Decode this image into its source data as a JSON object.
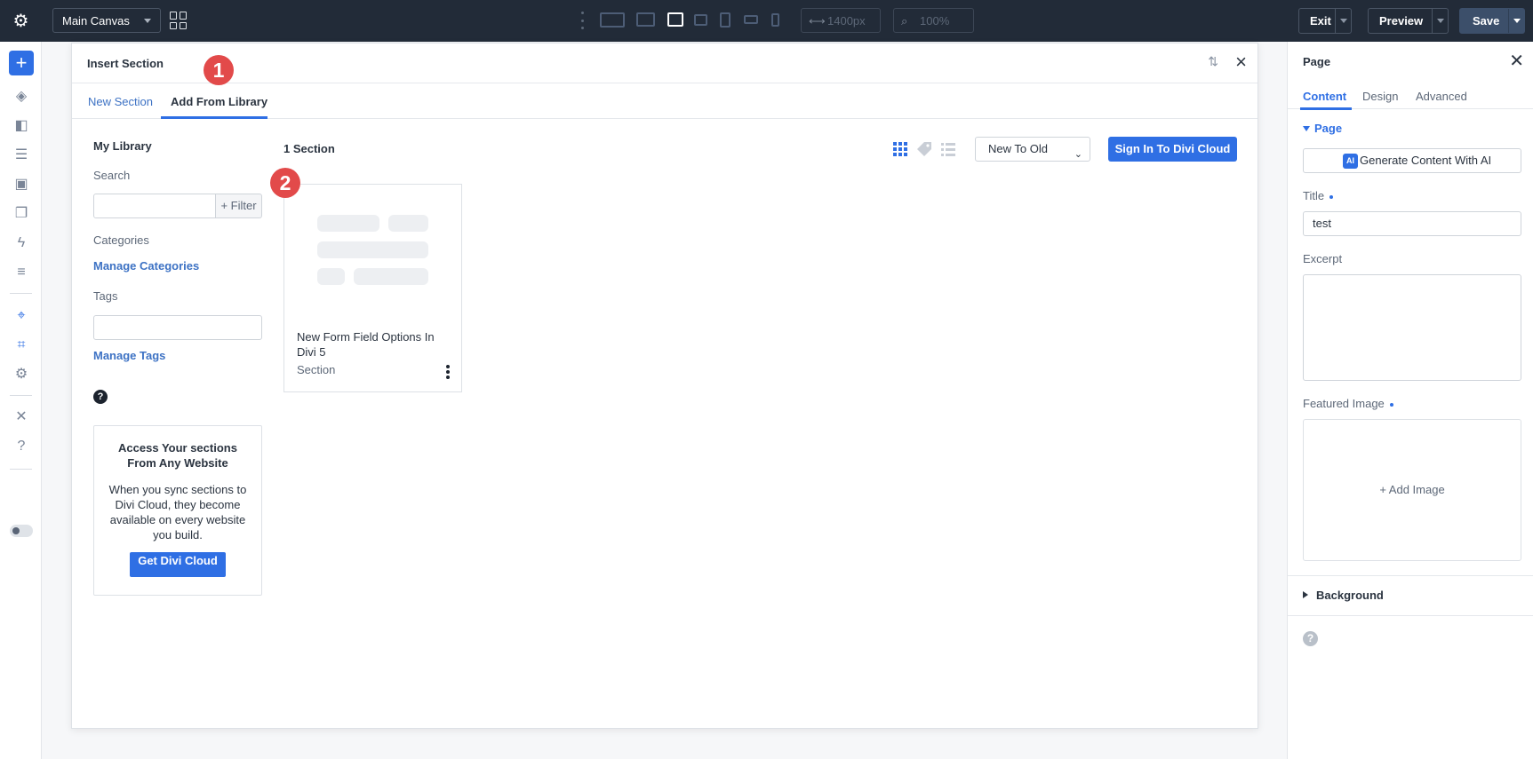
{
  "topbar": {
    "canvas_name": "Main Canvas",
    "width_value": "1400px",
    "zoom_value": "100%",
    "exit_label": "Exit",
    "preview_label": "Preview",
    "save_label": "Save"
  },
  "modal": {
    "title": "Insert Section",
    "tabs": [
      "New Section",
      "Add From Library"
    ],
    "annotation_1": "1",
    "annotation_2": "2"
  },
  "library": {
    "heading": "My Library",
    "search_label": "Search",
    "filter_label": "+ Filter",
    "categories_label": "Categories",
    "manage_categories": "Manage Categories",
    "tags_label": "Tags",
    "manage_tags": "Manage Tags",
    "help_icon": "?",
    "promo": {
      "title": "Access Your sections From Any Website",
      "text": "When you sync sections to Divi Cloud, they become available on every website you build.",
      "button": "Get Divi Cloud"
    }
  },
  "results": {
    "count": "1 Section",
    "sort_value": "New To Old",
    "cloud_button": "Sign In To Divi Cloud",
    "items": [
      {
        "title": "New Form Field Options In Divi 5",
        "type": "Section"
      }
    ]
  },
  "right_panel": {
    "title": "Page",
    "tabs": [
      "Content",
      "Design",
      "Advanced"
    ],
    "section_title": "Page",
    "ai_badge": "AI",
    "ai_button": "Generate Content With AI",
    "title_label": "Title",
    "title_value": "test",
    "excerpt_label": "Excerpt",
    "featured_label": "Featured Image",
    "add_image": "+ Add Image",
    "background_label": "Background",
    "help_icon": "?"
  },
  "colors": {
    "accent": "#2f6fe4",
    "topbar_bg": "#222b38",
    "badge_red": "#e24a4a"
  }
}
